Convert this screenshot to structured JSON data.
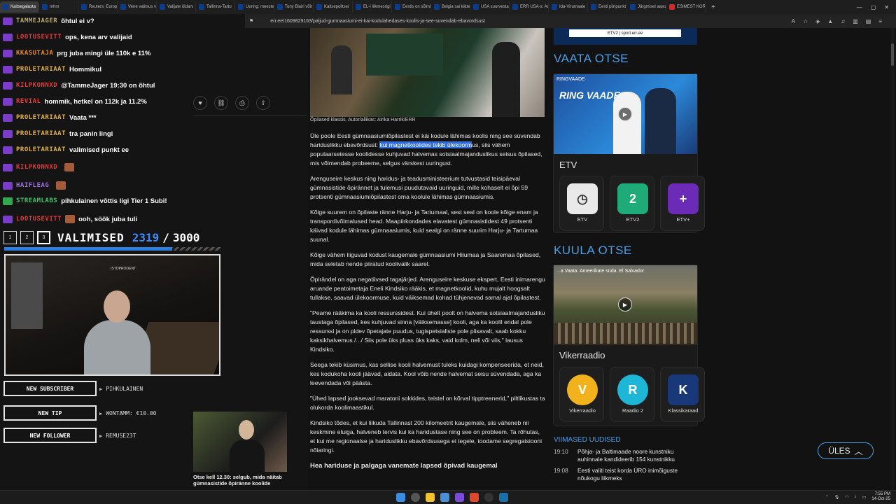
{
  "tabs": [
    {
      "label": "Kaitsegalasta",
      "active": true
    },
    {
      "label": "mhm"
    },
    {
      "label": "Reuters: Europe"
    },
    {
      "label": "Vene valitsus v"
    },
    {
      "label": "Valijate öldarv"
    },
    {
      "label": "Tallinna-Tartu"
    },
    {
      "label": "Uuring: meeste"
    },
    {
      "label": "Tony Blairi võit"
    },
    {
      "label": "Kaitsepolitsei"
    },
    {
      "label": "EL-i liikmesrigi"
    },
    {
      "label": "Eestis on sõlmi"
    },
    {
      "label": "Belgia sai kätte"
    },
    {
      "label": "USA suurvestan"
    },
    {
      "label": "ERR USA-s: Am"
    },
    {
      "label": "Ida-Virumaale"
    },
    {
      "label": "Eesti piiripunkt"
    },
    {
      "label": "Järgmisel aasta"
    },
    {
      "label": "ESIMEST KORD"
    }
  ],
  "new_tab_label": "+",
  "url": "err.ee/1609829163/paljud-gumnaasiumi-ei-kai-kodulahedases-koolis-ja-see-suvendab-ebavordsust",
  "chat": [
    {
      "name": "TAMMEJAGER",
      "color": "#b8a96a",
      "msg": "õhtul ei v?"
    },
    {
      "name": "LOOTUSEVITT",
      "color": "#e23a3a",
      "msg": "ops, kena arv valijaid"
    },
    {
      "name": "KKASUTAJA",
      "color": "#e08a2a",
      "msg": "prg juba mingi üle 110k e 11%"
    },
    {
      "name": "PROLETARIAAT",
      "color": "#e0b040",
      "msg": "Hommikul"
    },
    {
      "name": "KILPKONNXD",
      "color": "#e23a3a",
      "msg": "@TammeJager 19:30 on õhtul"
    },
    {
      "name": "REVIAL",
      "color": "#e23a3a",
      "msg": "hommik, hetkel on 112k ja 11.2%"
    },
    {
      "name": "PROLETARIAAT",
      "color": "#e0b040",
      "msg": "Vaata ***"
    },
    {
      "name": "PROLETARIAAT",
      "color": "#e0b040",
      "msg": "tra panin lingi"
    },
    {
      "name": "PROLETARIAAT",
      "color": "#e0b040",
      "msg": "valimised punkt ee"
    },
    {
      "name": "KILPKONNXD",
      "color": "#e23a3a",
      "msg": ""
    },
    {
      "name": "HAIFLEAG",
      "color": "#9a6ee0",
      "msg": ""
    },
    {
      "name": "STREAMLABS",
      "color": "#39c46a",
      "msg": "pihkulainen vōttis ligi Tier 1 Subi!"
    },
    {
      "name": "LOOTUSEVITT",
      "color": "#e23a3a",
      "msg": "ooh, söök juba tuli"
    }
  ],
  "goal": {
    "steps": [
      "1",
      "2",
      "3"
    ],
    "title": "VALIMISED",
    "current": "2319",
    "separator": "/",
    "target": "3000",
    "progress_fraction": 0.773
  },
  "cam_label": "ISTOPROOENT",
  "alerts": [
    {
      "label": "NEW SUBSCRIBER",
      "value": "PIHKULAINEN"
    },
    {
      "label": "NEW TIP",
      "value": "WONTAMM: €10.00"
    },
    {
      "label": "NEW FOLLOWER",
      "value": "REMUSE23T"
    }
  ],
  "article": {
    "caption": "Õpilased klassis. Autor/allikas: Airika Harrik/ERR",
    "p1_a": "Üle poole Eesti gümnaasiumiõpilastest ei käi kodule lähimas koolis ning see süvendab hariduslikku ebavõrdsust: ",
    "p1_hl": "kui magnetkoolides tekib ülekoorm",
    "p1_b": "us, siis vähem populaarsetesse koolidesse kuhjuvad halvemas sotsiaalmajanduslikus seisus õpilased, mis võimendab probeeme, selgus värskest uuringust.",
    "p2": "Arenguseire keskus ning haridus- ja teadusministeerium tutvustasid teisipäeval gümnasistide õpirännet ja tulemusi puudutavaid uuringuid, mille kohaselt ei õpi 59 protsenti gümnaasiumiõpilastest oma koolule lähimas gümnaasiumis.",
    "p3": "Kõige suurem on õpilaste ränne Harju- ja Tartumaal, sest seal on koole kõige enam ja transpordivõimalused head. Maapiirkondades elavatest gümnasistidest 49 protsenti käivad kodule lähimas gümnaasiumis, kuid sealgi on ränne suurim Harju- ja Tartumaa suunal.",
    "p4": "Kõige vähem liiguvad kodust kaugemale gümnaasiumi Hiiumaa ja Saaremaa õpilased, mida seletab nende piiratud koolivalik saarel.",
    "p5": "Õpirändel on aga negatiivsed tagajärjed. Arenguseire keskuse ekspert, Eesti inimarengu aruande peatoimetaja Eneli Kindsiko rääkis, et magnetkoolid, kuhu mujalt hoogsalt tullakse, saavad ülekoormuse, kuid väiksemad kohad tühjenevad samal ajal õpilastest.",
    "p6": "\"Peame rääkima ka kooli ressurssidest. Kui ühelt poolt on halvema sotsiaalmajandusliku taustaga õpilased, kes kuhjuvad sinna [väiksemasse] kooli, aga ka koolil endal pole ressurssi ja on pidev õpetajate puudus, tugispetsialiste pole piisavalt, saab kokku kaksikhalvemus /.../ Siis pole üks pluss üks kaks, vaid kolm, neli või viis,\" lausus Kindsiko.",
    "p7": "Seega tekib küsimus, kas sellise kooli halvemust tuleks kuidagi kompenseerida, et neid, kes kodukoha kooli jäävad, aidata. Kool võib nende halvemat seisu süvendada, aga ka leevendada või päästa.",
    "p8": "\"Ühed lapsed jooksevad maratoni sokkides, teistel on kõrval tipptreenerid,\" piltlikustas ta olukorda koolimaastikul.",
    "p9": "Kindsiko tõdes, et kui liikuda Tallinnast 200 kilomeetrit kaugemale, siis väheneb nii keskmine eluiga, halveneb tervis kui ka haridustase ning see on probleem. Ta rõhutas, et kui me regionaalse ja hariduslikku ebavõrdsusega ei tegele, toodame segregatsiooni nõiaringi.",
    "subheading": "Hea hariduse ja palgaga vanemate lapsed õpivad kaugemal",
    "related_title": "Otse kell 12.30: selgub, mida näitab gümnasistide õpiränne koolide"
  },
  "sidebar": {
    "banner_text": "ETV2 | sport.err.ee",
    "vaata_otse": "VAATA OTSE",
    "tv_tag": "RINGVAADE",
    "tv_logo": "RING VAADE",
    "tv_title": "ETV",
    "tv_channels": [
      "ETV",
      "ETV2",
      "ETV+"
    ],
    "kuula_otse": "KUULA OTSE",
    "radio_tag": "...a Vaata: Ameerikate süda. El Salvador",
    "radio_title": "Vikerraadio",
    "radio_channels": [
      "Vikerraadio",
      "Raadio 2",
      "Klassikaraad"
    ],
    "news_heading": "VIIMASED UUDISED",
    "news": [
      {
        "time": "19:10",
        "text": "Põhja- ja Baltimaade noore kunstniku auhinnale kandideerib 154 kunstnikku"
      },
      {
        "time": "19:08",
        "text": "Eesti valiti teist korda ÜRO inimõiguste nõukogu liikmeks"
      }
    ],
    "ules_label": "ÜLES"
  },
  "taskbar": {
    "time": "7:55 PM",
    "date": "14-Oct-25"
  },
  "colors": {
    "accent_blue": "#4a9fe8",
    "highlight": "#2f6ddf",
    "goal_blue": "#2f7fe0"
  }
}
